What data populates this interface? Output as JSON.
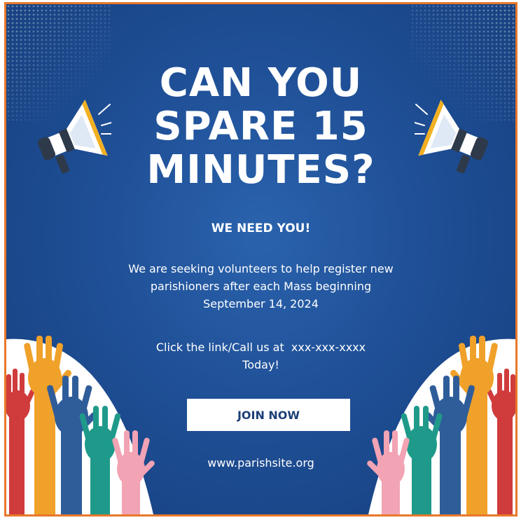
{
  "headline": [
    "CAN YOU",
    "SPARE 15",
    "MINUTES?"
  ],
  "subhead": "WE NEED YOU!",
  "body_lines": [
    "We are seeking volunteers to help register new",
    "parishioners after each Mass beginning",
    "September 14, 2024"
  ],
  "contact_lines": [
    "Click the link/Call us at  xxx-xxx-xxxx",
    "Today!"
  ],
  "join_button": "JOIN NOW",
  "website": "www.parishsite.org",
  "colors": {
    "background": "#1f4f96",
    "border": "#e8782a",
    "text": "#ffffff",
    "button_text": "#1c3f77",
    "hand_colors": [
      "#d03b3b",
      "#f0a12a",
      "#2f5d9a",
      "#1f9a8a",
      "#f2a3b4"
    ]
  },
  "icons": [
    "megaphone-icon",
    "raised-hands-illustration"
  ]
}
